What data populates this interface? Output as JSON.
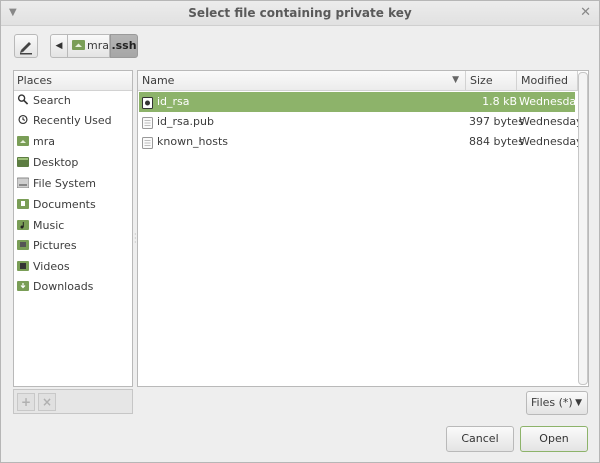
{
  "window": {
    "title": "Select file containing private key"
  },
  "pathbar": {
    "segments": [
      "mra",
      ".ssh"
    ],
    "active": ".ssh"
  },
  "places": {
    "header": "Places",
    "items": [
      {
        "label": "Search",
        "icon": "search-icon"
      },
      {
        "label": "Recently Used",
        "icon": "recent-icon"
      },
      {
        "label": "mra",
        "icon": "home-folder-icon"
      },
      {
        "label": "Desktop",
        "icon": "desktop-icon"
      },
      {
        "label": "File System",
        "icon": "drive-icon"
      },
      {
        "label": "Documents",
        "icon": "documents-folder-icon"
      },
      {
        "label": "Music",
        "icon": "music-folder-icon"
      },
      {
        "label": "Pictures",
        "icon": "pictures-folder-icon"
      },
      {
        "label": "Videos",
        "icon": "videos-folder-icon"
      },
      {
        "label": "Downloads",
        "icon": "downloads-folder-icon"
      }
    ],
    "footer": {
      "add": "+",
      "remove": "×"
    }
  },
  "files": {
    "columns": {
      "name": "Name",
      "size": "Size",
      "modified": "Modified"
    },
    "rows": [
      {
        "name": "id_rsa",
        "size": "1.8 kB",
        "modified": "Wednesday",
        "selected": true,
        "icon": "key-file-icon"
      },
      {
        "name": "id_rsa.pub",
        "size": "397 bytes",
        "modified": "Wednesday",
        "selected": false,
        "icon": "text-file-icon"
      },
      {
        "name": "known_hosts",
        "size": "884 bytes",
        "modified": "Wednesday",
        "selected": false,
        "icon": "text-file-icon"
      }
    ]
  },
  "filter": {
    "value": "Files (*)"
  },
  "buttons": {
    "cancel": "Cancel",
    "open": "Open"
  },
  "colors": {
    "selection": "#8db36a",
    "folder_green": "#7a9e57"
  }
}
